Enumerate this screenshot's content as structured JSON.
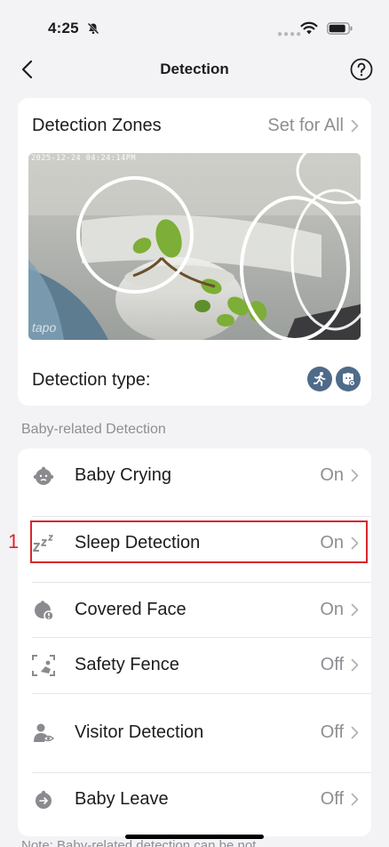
{
  "status": {
    "time": "4:25"
  },
  "nav": {
    "title": "Detection"
  },
  "zones": {
    "title": "Detection Zones",
    "set_all_label": "Set for All",
    "camera_timestamp": "2025-12-24 04:24:14PM",
    "camera_logo": "tapo",
    "detection_type_label": "Detection type:",
    "detection_type_icons": [
      "person-running-icon",
      "pet-paw-icon"
    ]
  },
  "section": {
    "header": "Baby-related Detection"
  },
  "items": [
    {
      "label": "Baby Crying",
      "value": "On",
      "icon": "baby-face-icon"
    },
    {
      "label": "Sleep Detection",
      "value": "On",
      "icon": "sleep-zzz-icon"
    },
    {
      "label": "Covered Face",
      "value": "On",
      "icon": "covered-face-icon"
    },
    {
      "label": "Safety Fence",
      "value": "Off",
      "icon": "safety-fence-icon"
    },
    {
      "label": "Visitor Detection",
      "value": "Off",
      "icon": "visitor-icon"
    },
    {
      "label": "Baby Leave",
      "value": "Off",
      "icon": "baby-leave-icon"
    }
  ],
  "annotation": {
    "number": "1"
  },
  "footer": {
    "note": "Note: Baby-related detection can be not"
  },
  "colors": {
    "accent": "#4f6b8a",
    "highlight": "#d9262e",
    "muted": "#8e8e93"
  }
}
